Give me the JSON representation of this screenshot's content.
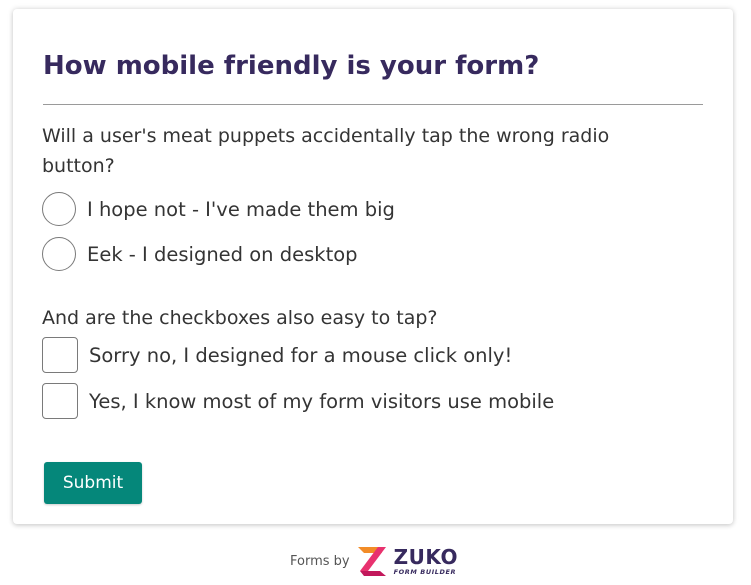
{
  "form": {
    "title": "How mobile friendly is your form?",
    "question1": {
      "text": "Will a user's meat puppets accidentally tap the wrong radio button?",
      "options": [
        "I hope not - I've made them big",
        "Eek - I designed on desktop"
      ]
    },
    "question2": {
      "text": "And are the checkboxes also easy to tap?",
      "options": [
        "Sorry no, I designed for a mouse click only!",
        "Yes, I know most of my form visitors use mobile"
      ]
    },
    "submit_label": "Submit"
  },
  "footer": {
    "forms_by": "Forms by",
    "logo_word": "ZUKO",
    "logo_sub": "FORM BUILDER"
  },
  "colors": {
    "title": "#372a5e",
    "submit_bg": "#05877a",
    "logo_pink": "#e8326f",
    "logo_orange": "#f28c28"
  }
}
